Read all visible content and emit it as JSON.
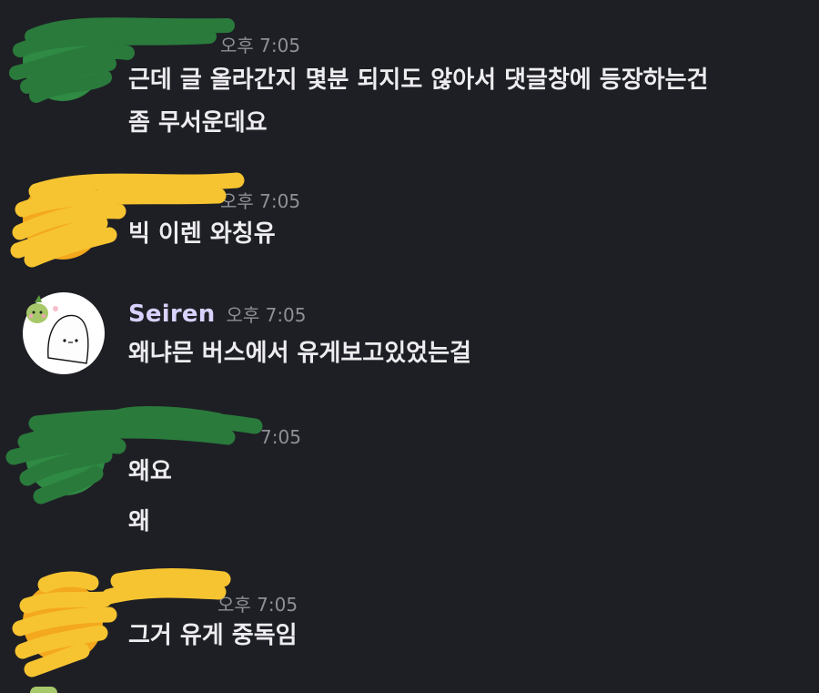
{
  "messages": [
    {
      "author": "",
      "time": "오후 7:05",
      "lines": [
        "근데 글 올라간지 몇분 되지도 않아서 댓글창에 등장하는건",
        "좀 무서운데요"
      ]
    },
    {
      "author": "",
      "time": "오후 7:05",
      "lines": [
        "빅 이렌 와칭유"
      ]
    },
    {
      "author": "Seiren",
      "time": "오후 7:05",
      "lines": [
        "왜냐믄 버스에서 유게보고있었는걸"
      ]
    },
    {
      "author": "",
      "time": "7:05",
      "lines": [
        "왜요",
        "왜"
      ]
    },
    {
      "author": "",
      "time": "오후 7:05",
      "lines": [
        "그거 유게 중독임"
      ]
    }
  ],
  "colors": {
    "background": "#1e1f24",
    "green_redaction": "#2a7a3c",
    "yellow_redaction": "#f6c431",
    "seiren_name": "#d9d2ff"
  }
}
